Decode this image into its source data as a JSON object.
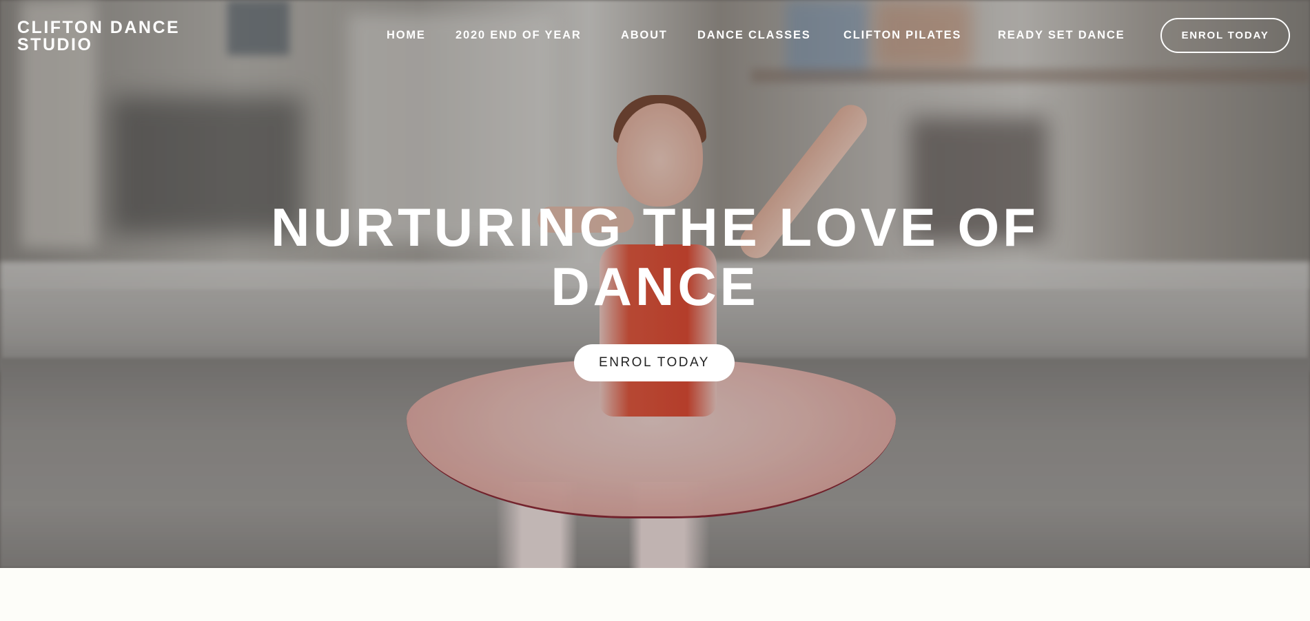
{
  "site": {
    "title": "CLIFTON DANCE STUDIO"
  },
  "nav": {
    "items": [
      {
        "label": "HOME"
      },
      {
        "label": "2020 END OF YEAR"
      },
      {
        "label": "ABOUT"
      },
      {
        "label": "DANCE CLASSES"
      },
      {
        "label": "CLIFTON PILATES"
      },
      {
        "label": "READY SET DANCE"
      }
    ],
    "cta_label": "ENROL TODAY"
  },
  "hero": {
    "heading": "NURTURING THE LOVE OF DANCE",
    "cta_label": "ENROL TODAY",
    "image_alt": "Young ballerina in a pink tutu dancing in a studio"
  },
  "colors": {
    "header_text": "#ffffff",
    "page_background": "#fdfdf9",
    "button_fill": "#ffffff",
    "button_text": "#222222"
  }
}
